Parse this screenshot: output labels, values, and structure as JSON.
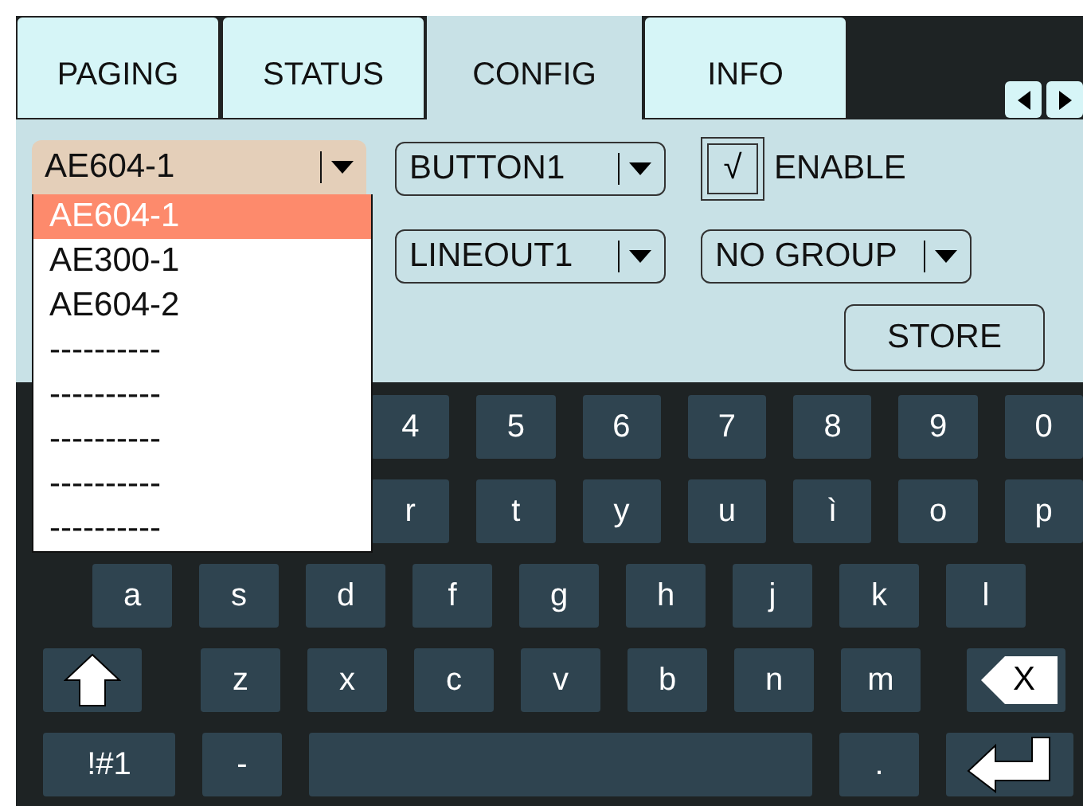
{
  "tabs": [
    {
      "label": "PAGING",
      "selected": false
    },
    {
      "label": "STATUS",
      "selected": false
    },
    {
      "label": "CONFIG",
      "selected": true
    },
    {
      "label": "INFO",
      "selected": false
    }
  ],
  "device_select": {
    "value": "AE604-1",
    "options": [
      {
        "label": "AE604-1",
        "selected": true
      },
      {
        "label": "AE300-1",
        "selected": false
      },
      {
        "label": "AE604-2",
        "selected": false
      },
      {
        "label": "----------",
        "selected": false
      },
      {
        "label": "----------",
        "selected": false
      },
      {
        "label": "----------",
        "selected": false
      },
      {
        "label": "----------",
        "selected": false
      },
      {
        "label": "----------",
        "selected": false
      }
    ]
  },
  "button_select": {
    "value": "BUTTON1"
  },
  "enable": {
    "label": "ENABLE",
    "mark": "√",
    "checked": true
  },
  "output_select": {
    "value": "LINEOUT1"
  },
  "group_select": {
    "value": "NO GROUP"
  },
  "store_button": {
    "label": "STORE"
  },
  "keyboard": {
    "number_row": {
      "keys": [
        {
          "kind": "char",
          "label": "4"
        },
        {
          "kind": "char",
          "label": "5"
        },
        {
          "kind": "char",
          "label": "6"
        },
        {
          "kind": "char",
          "label": "7"
        },
        {
          "kind": "char",
          "label": "8"
        },
        {
          "kind": "char",
          "label": "9"
        },
        {
          "kind": "char",
          "label": "0"
        }
      ]
    },
    "upper_row": {
      "keys": [
        {
          "kind": "char",
          "label": "r"
        },
        {
          "kind": "char",
          "label": "t"
        },
        {
          "kind": "char",
          "label": "y"
        },
        {
          "kind": "char",
          "label": "u"
        },
        {
          "kind": "char",
          "label": "ì"
        },
        {
          "kind": "char",
          "label": "o"
        },
        {
          "kind": "char",
          "label": "p"
        }
      ]
    },
    "home_row": {
      "keys": [
        {
          "kind": "char",
          "label": "a"
        },
        {
          "kind": "char",
          "label": "s"
        },
        {
          "kind": "char",
          "label": "d"
        },
        {
          "kind": "char",
          "label": "f"
        },
        {
          "kind": "char",
          "label": "g"
        },
        {
          "kind": "char",
          "label": "h"
        },
        {
          "kind": "char",
          "label": "j"
        },
        {
          "kind": "char",
          "label": "k"
        },
        {
          "kind": "char",
          "label": "l"
        }
      ]
    },
    "lower_row": {
      "keys": [
        {
          "kind": "shift"
        },
        {
          "kind": "char",
          "label": "z"
        },
        {
          "kind": "char",
          "label": "x"
        },
        {
          "kind": "char",
          "label": "c"
        },
        {
          "kind": "char",
          "label": "v"
        },
        {
          "kind": "char",
          "label": "b"
        },
        {
          "kind": "char",
          "label": "n"
        },
        {
          "kind": "char",
          "label": "m"
        },
        {
          "kind": "backspace",
          "label": "X"
        }
      ]
    },
    "bottom_row": {
      "keys": [
        {
          "kind": "symbols",
          "label": "!#1"
        },
        {
          "kind": "char",
          "label": "-"
        },
        {
          "kind": "space"
        },
        {
          "kind": "char",
          "label": "."
        },
        {
          "kind": "enter"
        }
      ]
    }
  }
}
